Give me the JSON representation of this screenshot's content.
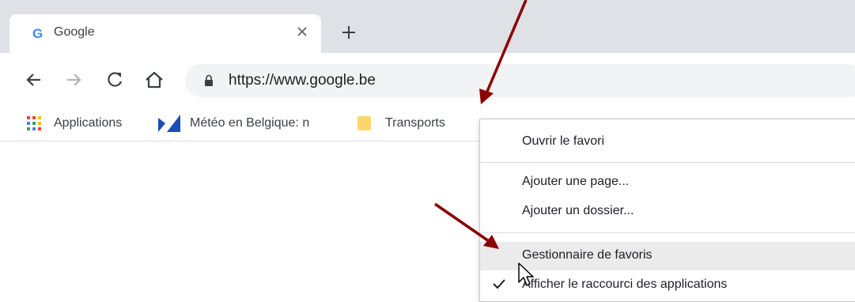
{
  "browser": {
    "tab": {
      "title": "Google",
      "favicon": "google-g-icon"
    },
    "url": "https://www.google.be"
  },
  "bookmarks": [
    {
      "label": "Applications",
      "icon": "apps-grid-icon"
    },
    {
      "label": "Météo en Belgique: n",
      "icon": "meteo-logo-icon"
    },
    {
      "label": "Transports",
      "icon": "folder-icon"
    }
  ],
  "context_menu": {
    "items": [
      {
        "label": "Ouvrir le favori"
      },
      {
        "label": "Ajouter une page..."
      },
      {
        "label": "Ajouter un dossier..."
      },
      {
        "label": "Gestionnaire de favoris",
        "highlighted": true
      },
      {
        "label": "Afficher le raccourci des applications",
        "checked": true
      }
    ]
  },
  "colors": {
    "tabstrip": "#dee1e6",
    "omnibox": "#f1f3f4",
    "annotation_arrow": "#8b0000"
  }
}
